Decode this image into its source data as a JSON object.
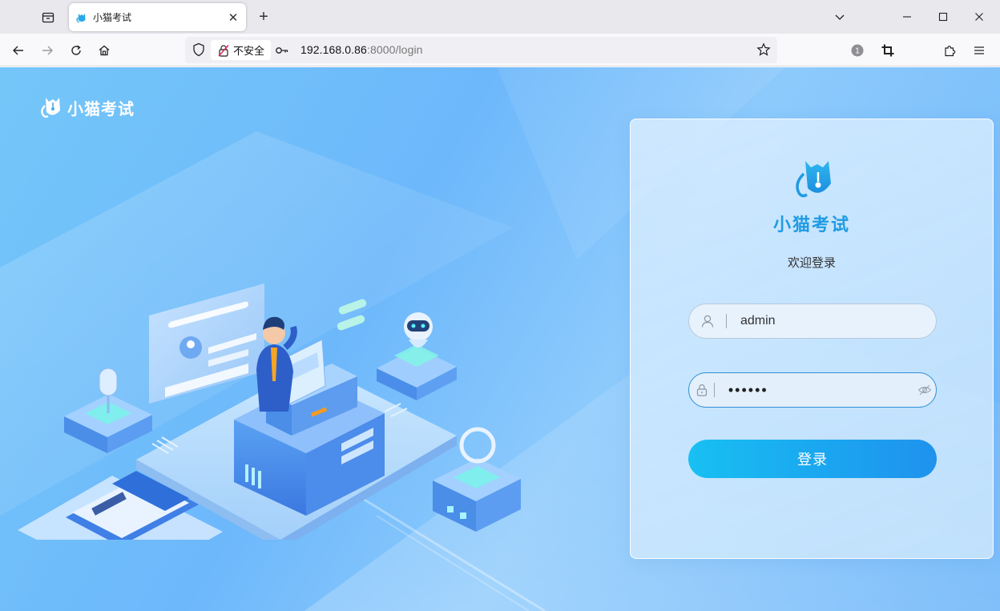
{
  "browser": {
    "tab_title": "小猫考试",
    "url_security_label": "不安全",
    "url_host": "192.168.0.86",
    "url_path": ":8000/login",
    "extensions_badge": "1"
  },
  "brand": {
    "name": "小猫考试"
  },
  "login_card": {
    "title": "小猫考试",
    "subtitle": "欢迎登录",
    "username_value": "admin",
    "password_value": "••••••",
    "submit_label": "登录"
  },
  "colors": {
    "accent": "#1f9be3",
    "button_start": "#18c0f2",
    "button_end": "#1f92ee",
    "page_bg": "#74c6f9"
  },
  "icons": {
    "tab_list": "tab-list-icon",
    "back": "back-arrow-icon",
    "forward": "forward-arrow-icon",
    "reload": "reload-icon",
    "home": "home-icon",
    "shield": "shield-icon",
    "insecure": "insecure-lock-icon",
    "permissions": "key-icon",
    "bookmark": "star-icon",
    "crop": "crop-icon",
    "extensions": "puzzle-icon",
    "menu": "hamburger-menu-icon",
    "user": "user-icon",
    "lock": "lock-icon",
    "eye": "eye-icon"
  }
}
